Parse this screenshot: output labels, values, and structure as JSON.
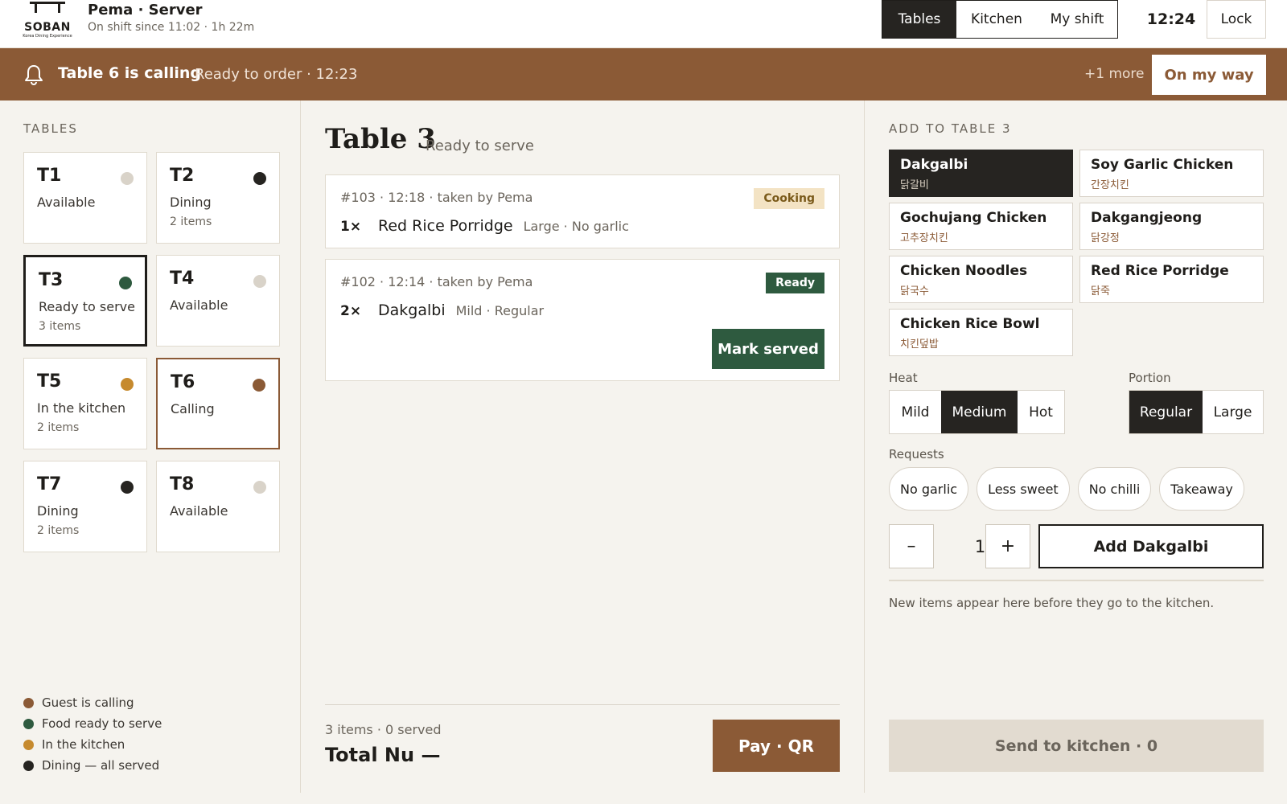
{
  "brand": {
    "name": "SOBAN",
    "tagline": "Korea Dining Experience"
  },
  "user": {
    "name": "Pema · Server",
    "shift": "On shift since 11:02 · 1h 22m"
  },
  "nav": {
    "tabs": [
      {
        "label": "Tables",
        "active": true
      },
      {
        "label": "Kitchen"
      },
      {
        "label": "My shift"
      }
    ]
  },
  "clock": "12:24",
  "lock_label": "Lock",
  "banner": {
    "title": "Table 6 is calling",
    "subtitle": "Ready to order · 12:23",
    "more": "+1 more",
    "action": "On my way"
  },
  "tables_label": "TABLES",
  "tables": [
    {
      "id": "T1",
      "status": "Available",
      "items": "",
      "dot": "#d9d3c9"
    },
    {
      "id": "T2",
      "status": "Dining",
      "items": "2 items",
      "dot": "#262421"
    },
    {
      "id": "T3",
      "status": "Ready to serve",
      "items": "3 items",
      "dot": "#2e5a3f",
      "selected": true
    },
    {
      "id": "T4",
      "status": "Available",
      "items": "",
      "dot": "#d9d3c9"
    },
    {
      "id": "T5",
      "status": "In the kitchen",
      "items": "2 items",
      "dot": "#c68a2e"
    },
    {
      "id": "T6",
      "status": "Calling",
      "items": "",
      "dot": "#8b5a36",
      "calling": true
    },
    {
      "id": "T7",
      "status": "Dining",
      "items": "2 items",
      "dot": "#262421"
    },
    {
      "id": "T8",
      "status": "Available",
      "items": "",
      "dot": "#d9d3c9"
    }
  ],
  "legend": [
    {
      "label": "Guest is calling",
      "color": "#8b5a36"
    },
    {
      "label": "Food ready to serve",
      "color": "#2e5a3f"
    },
    {
      "label": "In the kitchen",
      "color": "#c68a2e"
    },
    {
      "label": "Dining — all served",
      "color": "#262421"
    }
  ],
  "detail": {
    "title": "Table 3",
    "subtitle": "Ready to serve",
    "orders": [
      {
        "meta": "#103 · 12:18 · taken by Pema",
        "badge": "Cooking",
        "badge_bg": "#f3e3c4",
        "badge_fg": "#7a5a1a",
        "qty": "1×",
        "name": "Red Rice Porridge",
        "opts": "Large · No garlic"
      },
      {
        "meta": "#102 · 12:14 · taken by Pema",
        "badge": "Ready",
        "badge_bg": "#2e5a3f",
        "badge_fg": "#ffffff",
        "qty": "2×",
        "name": "Dakgalbi",
        "opts": "Mild · Regular",
        "action": "Mark served"
      }
    ],
    "count": "3 items · 0 served",
    "total": "Total Nu —",
    "pay": "Pay · QR"
  },
  "add": {
    "title": "ADD TO TABLE 3",
    "menu": [
      {
        "name": "Dakgalbi",
        "ko": "닭갈비",
        "active": true
      },
      {
        "name": "Soy Garlic Chicken",
        "ko": "간장치킨"
      },
      {
        "name": "Gochujang Chicken",
        "ko": "고추장치킨"
      },
      {
        "name": "Dakgangjeong",
        "ko": "닭강정"
      },
      {
        "name": "Chicken Noodles",
        "ko": "닭국수"
      },
      {
        "name": "Red Rice Porridge",
        "ko": "닭죽"
      },
      {
        "name": "Chicken Rice Bowl",
        "ko": "치킨덮밥"
      }
    ],
    "heat_label": "Heat",
    "heat": [
      {
        "label": "Mild"
      },
      {
        "label": "Medium",
        "active": true
      },
      {
        "label": "Hot"
      }
    ],
    "portion_label": "Portion",
    "portion": [
      {
        "label": "Regular",
        "active": true
      },
      {
        "label": "Large"
      }
    ],
    "requests_label": "Requests",
    "requests": [
      "No garlic",
      "Less sweet",
      "No chilli",
      "Takeaway"
    ],
    "minus": "–",
    "qty": "1",
    "plus": "+",
    "add_label": "Add Dakgalbi",
    "hint": "New items appear here before they go to the kitchen.",
    "send": "Send to kitchen · 0"
  }
}
